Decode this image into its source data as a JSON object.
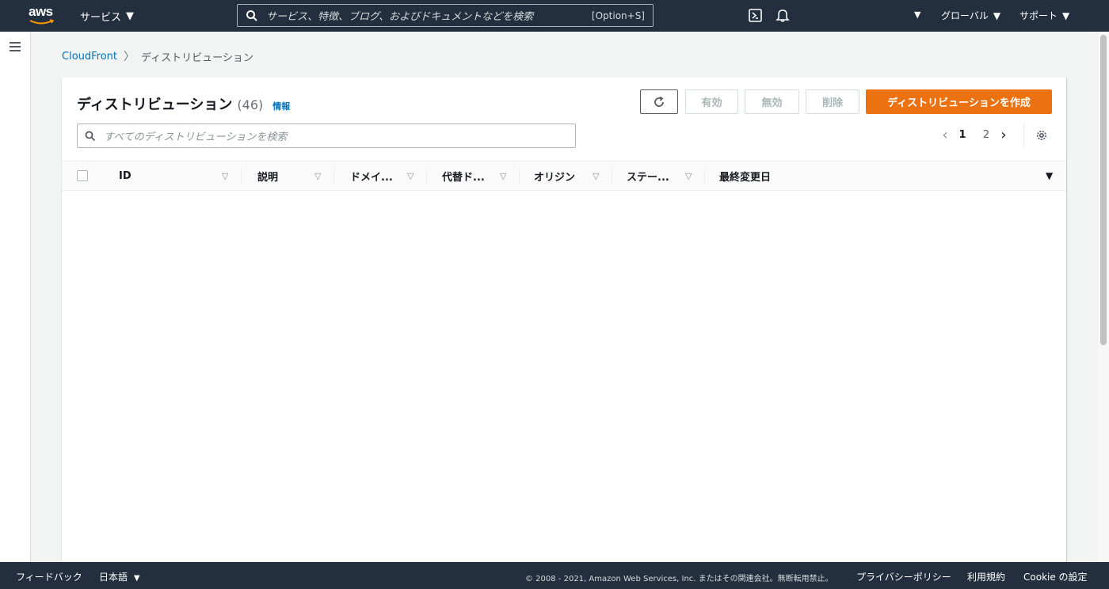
{
  "topnav": {
    "logo_text": "aws",
    "services_label": "サービス",
    "search_placeholder": "サービス、特徴、ブログ、およびドキュメントなどを検索",
    "search_shortcut": "[Option+S]",
    "region_label": "グローバル",
    "support_label": "サポート",
    "icons": [
      "cloudshell-icon",
      "bell-icon"
    ]
  },
  "breadcrumb": {
    "root": "CloudFront",
    "separator": ">",
    "current": "ディストリビューション"
  },
  "panel": {
    "title": "ディストリビューション",
    "count": "(46)",
    "info": "情報",
    "buttons": {
      "enable": "有効",
      "disable": "無効",
      "delete": "削除",
      "create": "ディストリビューションを作成"
    },
    "search_placeholder": "すべてのディストリビューションを検索",
    "pagination": {
      "pages": [
        "1",
        "2"
      ],
      "current": "1"
    }
  },
  "table": {
    "columns": [
      "ID",
      "説明",
      "ドメイ...",
      "代替ド...",
      "オリジン",
      "ステー...",
      "最終変更日"
    ],
    "rows": []
  },
  "footer": {
    "feedback": "フィードバック",
    "language": "日本語",
    "copyright": "© 2008 - 2021, Amazon Web Services, Inc. またはその関連会社。無断転用禁止。",
    "privacy": "プライバシーポリシー",
    "terms": "利用規約",
    "cookie": "Cookie の設定"
  },
  "colors": {
    "nav_bg": "#232f3e",
    "primary_button": "#ec7211",
    "link": "#0073bb",
    "page_bg": "#f2f3f3"
  }
}
